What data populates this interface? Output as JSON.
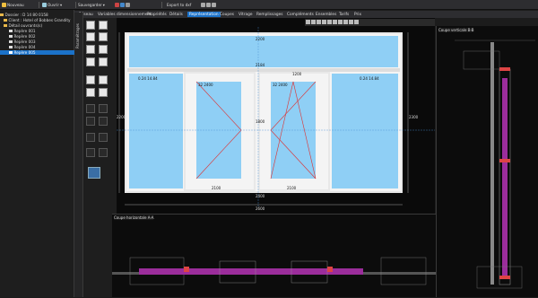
{
  "toolbar": {
    "new_label": "Nouveau",
    "open_label": "Ouvrir",
    "save_label": "Sauvegarder",
    "export_label": "Export to dxf"
  },
  "tree": {
    "folder": "Dossier : D 14 80 0158",
    "client": "Client : Hotel of Bobbes Grandity",
    "subfolder": "Détail ouvrants(s)",
    "items": [
      "Repère 001",
      "Repère 002",
      "Repère 003",
      "Repère 004",
      "Repère 005"
    ],
    "selected_index": 4
  },
  "side_tab": "Paramétrages",
  "tabs": [
    "Réseau",
    "Variables dimensionnement",
    "Propriétés",
    "Détails",
    "Représentation",
    "Coupes",
    "Vitrage",
    "Remplissages",
    "Compléments",
    "Ensembles",
    "Tarifs",
    "Prix"
  ],
  "active_tab": 4,
  "drawing": {
    "dims": {
      "top": "2200",
      "top_inner": "2184",
      "side_left": "2200",
      "side_right": "2300",
      "bottom": "2400",
      "bottom_total": "2600",
      "sash_left": "2100",
      "sash_center": "1200",
      "sash_right": "2100",
      "mid": "1800"
    },
    "glass_labels": {
      "top": "2100",
      "left": "0.24 14.84",
      "mid_left": "32 2400",
      "mid_right": "32 2400",
      "right": "0.24 14.84"
    },
    "section_h_title": "Coupe horizontale A-A",
    "section_v_title": "Coupe verticale B-B"
  }
}
